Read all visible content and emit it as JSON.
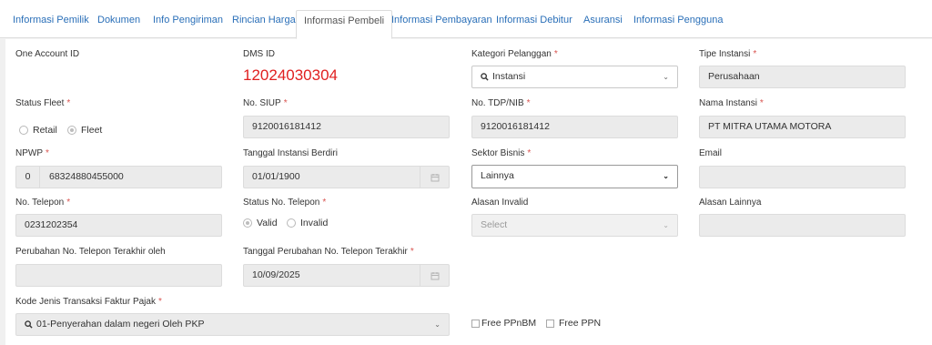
{
  "tabs": [
    {
      "label": "Informasi Pemilik"
    },
    {
      "label": "Dokumen"
    },
    {
      "label": "Info Pengiriman"
    },
    {
      "label": "Rincian Harga"
    },
    {
      "label": "Informasi Pembeli"
    },
    {
      "label": "Informasi Pembayaran"
    },
    {
      "label": "Informasi Debitur"
    },
    {
      "label": "Asuransi"
    },
    {
      "label": "Informasi Pengguna"
    }
  ],
  "active_tab": "Informasi Pembeli",
  "required_mark": "*",
  "form": {
    "one_account_id": {
      "label": "One Account ID"
    },
    "dms_id": {
      "label": "DMS ID",
      "value": "12024030304"
    },
    "kategori_pelanggan": {
      "label": "Kategori Pelanggan",
      "value": "Instansi"
    },
    "tipe_instansi": {
      "label": "Tipe Instansi",
      "value": "Perusahaan"
    },
    "status_fleet": {
      "label": "Status Fleet",
      "options": [
        "Retail",
        "Fleet"
      ],
      "selected": "Fleet"
    },
    "no_siup": {
      "label": "No. SIUP",
      "value": "9120016181412"
    },
    "no_tdp_nib": {
      "label": "No. TDP/NIB",
      "value": "9120016181412"
    },
    "nama_instansi": {
      "label": "Nama Instansi",
      "value": "PT MITRA UTAMA MOTORA"
    },
    "npwp": {
      "label": "NPWP",
      "prefix": "0",
      "value": "68324880455000"
    },
    "tanggal_instansi_berdiri": {
      "label": "Tanggal Instansi Berdiri",
      "value": "01/01/1900"
    },
    "sektor_bisnis": {
      "label": "Sektor Bisnis",
      "value": "Lainnya"
    },
    "email": {
      "label": "Email",
      "value": ""
    },
    "no_telepon": {
      "label": "No. Telepon",
      "value": "0231202354"
    },
    "status_no_telepon": {
      "label": "Status No. Telepon",
      "options": [
        "Valid",
        "Invalid"
      ],
      "selected": "Valid"
    },
    "alasan_invalid": {
      "label": "Alasan Invalid",
      "placeholder": "Select"
    },
    "alasan_lainnya": {
      "label": "Alasan Lainnya",
      "value": ""
    },
    "perubahan_no_telepon": {
      "label": "Perubahan No. Telepon Terakhir oleh",
      "value": ""
    },
    "tanggal_perubahan_no_telepon": {
      "label": "Tanggal Perubahan No. Telepon Terakhir",
      "value": "10/09/2025"
    },
    "kode_jenis_transaksi": {
      "label": "Kode Jenis Transaksi Faktur Pajak",
      "value": "01-Penyerahan dalam negeri Oleh PKP"
    },
    "free_ppnbm": {
      "label": "Free PPnBM",
      "checked": false
    },
    "free_ppn": {
      "label": "Free PPN",
      "checked": false
    }
  },
  "icons": {
    "search": "search-icon",
    "chevron": "chevron-down-icon",
    "calendar": "calendar-icon"
  },
  "colors": {
    "tab_link": "#2a6fb8",
    "dms_id": "#e02020",
    "required": "#d9534f",
    "readonly_field": "#ebebeb"
  }
}
